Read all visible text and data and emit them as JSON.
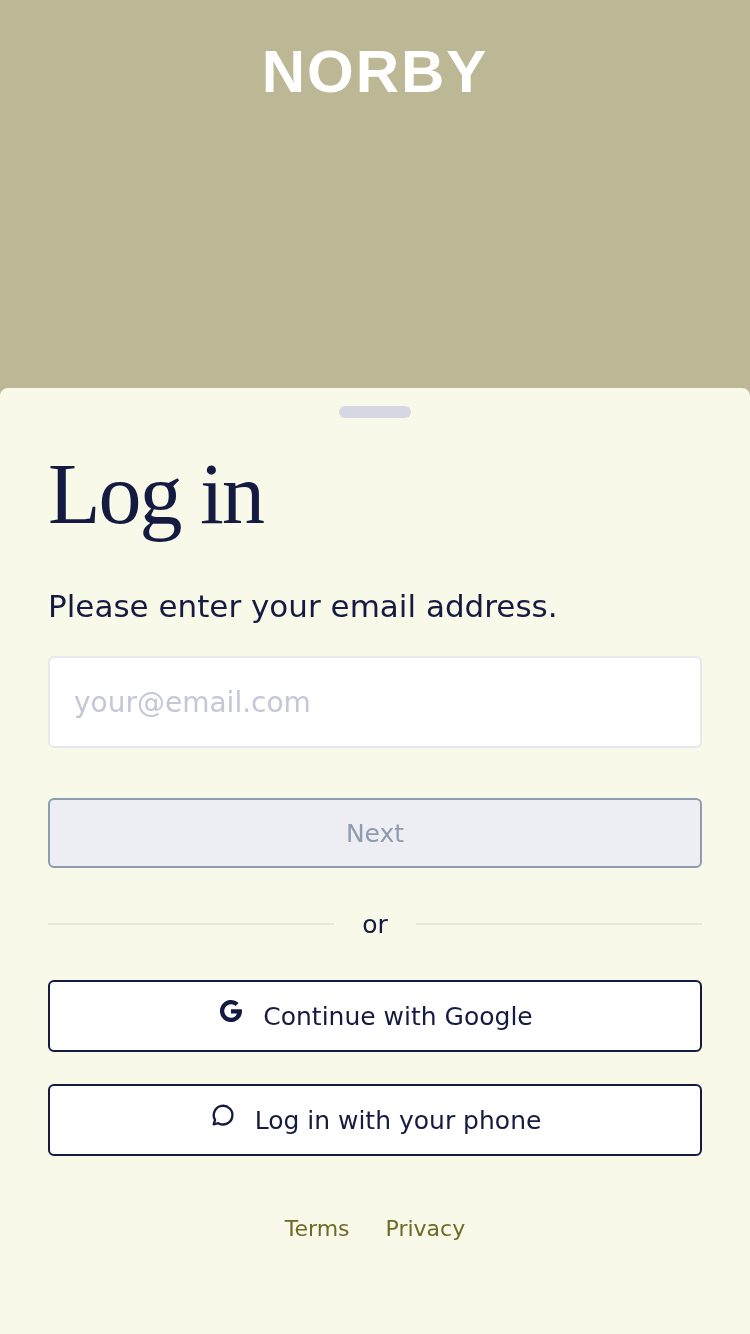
{
  "logo": "NORBY",
  "title": "Log in",
  "prompt": "Please enter your email address.",
  "email_field": {
    "placeholder": "your@email.com"
  },
  "next_button": {
    "label": "Next",
    "disabled": true
  },
  "divider": "or",
  "social_buttons": [
    {
      "kind": "google",
      "label": "Continue with Google"
    },
    {
      "kind": "phone",
      "label": "Log in with your phone"
    }
  ],
  "footer_links": [
    "Terms",
    "Privacy"
  ]
}
